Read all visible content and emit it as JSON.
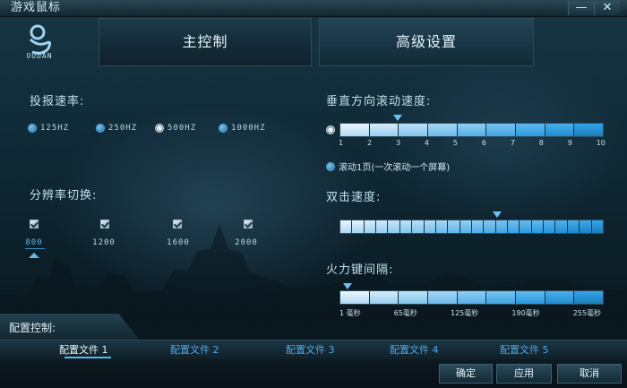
{
  "window": {
    "title": "游戏鼠标",
    "minimize_glyph": "—",
    "close_glyph": "✕"
  },
  "logo": {
    "text": "OUDAN"
  },
  "tabs": [
    {
      "label": "主控制"
    },
    {
      "label": "高级设置"
    }
  ],
  "report_rate": {
    "title": "投报速率:",
    "options": [
      {
        "label": "125HZ",
        "selected": false
      },
      {
        "label": "250HZ",
        "selected": false
      },
      {
        "label": "500HZ",
        "selected": true
      },
      {
        "label": "1000HZ",
        "selected": false
      }
    ]
  },
  "resolution": {
    "title": "分辨率切换:",
    "levels": [
      {
        "label": "800",
        "checked": true,
        "active": true
      },
      {
        "label": "1200",
        "checked": true,
        "active": false
      },
      {
        "label": "1600",
        "checked": true,
        "active": false
      },
      {
        "label": "2000",
        "checked": true,
        "active": false
      }
    ]
  },
  "vertical_scroll": {
    "title": "垂直方向滚动速度:",
    "value": 3,
    "ticks": [
      "1",
      "2",
      "3",
      "4",
      "5",
      "6",
      "7",
      "8",
      "9",
      "10"
    ],
    "page_option_label": "滚动1页(一次滚动一个屏幕)"
  },
  "double_click": {
    "title": "双击速度:",
    "level_fraction": 0.6
  },
  "fire_key": {
    "title": "火力键间隔:",
    "level_fraction": 0.0,
    "ticks": [
      "1 毫秒",
      "65毫秒",
      "125毫秒",
      "190毫秒",
      "255毫秒"
    ]
  },
  "profile": {
    "title": "配置控制:",
    "tabs": [
      "配置文件 1",
      "配置文件 2",
      "配置文件 3",
      "配置文件 4",
      "配置文件 5"
    ],
    "active_index": 0
  },
  "footer": {
    "ok": "确定",
    "apply": "应用",
    "cancel": "取消"
  }
}
